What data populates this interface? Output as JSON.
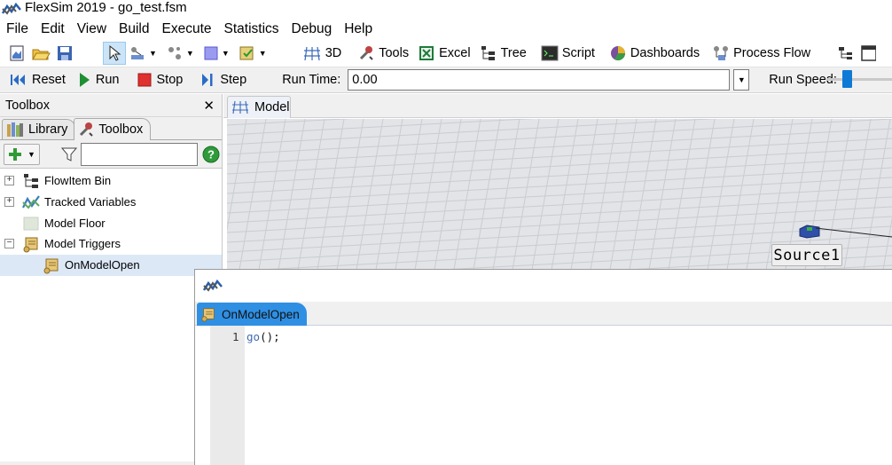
{
  "window": {
    "title": "FlexSim 2019 - go_test.fsm",
    "logo": "flexsim-logo"
  },
  "menu": {
    "items": [
      "File",
      "Edit",
      "View",
      "Build",
      "Execute",
      "Statistics",
      "Debug",
      "Help"
    ]
  },
  "toolbar": {
    "btn_3d": "3D",
    "btn_tools": "Tools",
    "btn_excel": "Excel",
    "btn_tree": "Tree",
    "btn_script": "Script",
    "btn_dashboards": "Dashboards",
    "btn_processflow": "Process Flow"
  },
  "runbar": {
    "reset": "Reset",
    "run": "Run",
    "stop": "Stop",
    "step": "Step",
    "runtime_label": "Run Time:",
    "runtime_value": "0.00",
    "runspeed_label": "Run Speed:"
  },
  "left_panel": {
    "title": "Toolbox",
    "close": "✕",
    "tabs": [
      "Library",
      "Toolbox"
    ],
    "active_tab": "Toolbox",
    "filter_value": "",
    "tree": [
      {
        "label": "FlowItem Bin",
        "expander": "+",
        "icon": "flowitem-bin-icon"
      },
      {
        "label": "Tracked Variables",
        "expander": "+",
        "icon": "tracked-variables-icon"
      },
      {
        "label": "Model Floor",
        "expander": "",
        "icon": "model-floor-icon"
      },
      {
        "label": "Model Triggers",
        "expander": "−",
        "icon": "scroll-icon"
      },
      {
        "label": "OnModelOpen",
        "expander": "",
        "icon": "scroll-icon",
        "selected": true
      }
    ]
  },
  "model": {
    "tab_label": "Model",
    "object_label": "Source1"
  },
  "editor": {
    "tab_label": "OnModelOpen",
    "line_number": "1",
    "code_fn": "go",
    "code_rest": "();"
  },
  "colors": {
    "grid_bg": "#e2e4e7",
    "grid_line": "#c9ccd1",
    "accent_blue": "#2f8fe3",
    "selected_row": "#dde8f6"
  }
}
